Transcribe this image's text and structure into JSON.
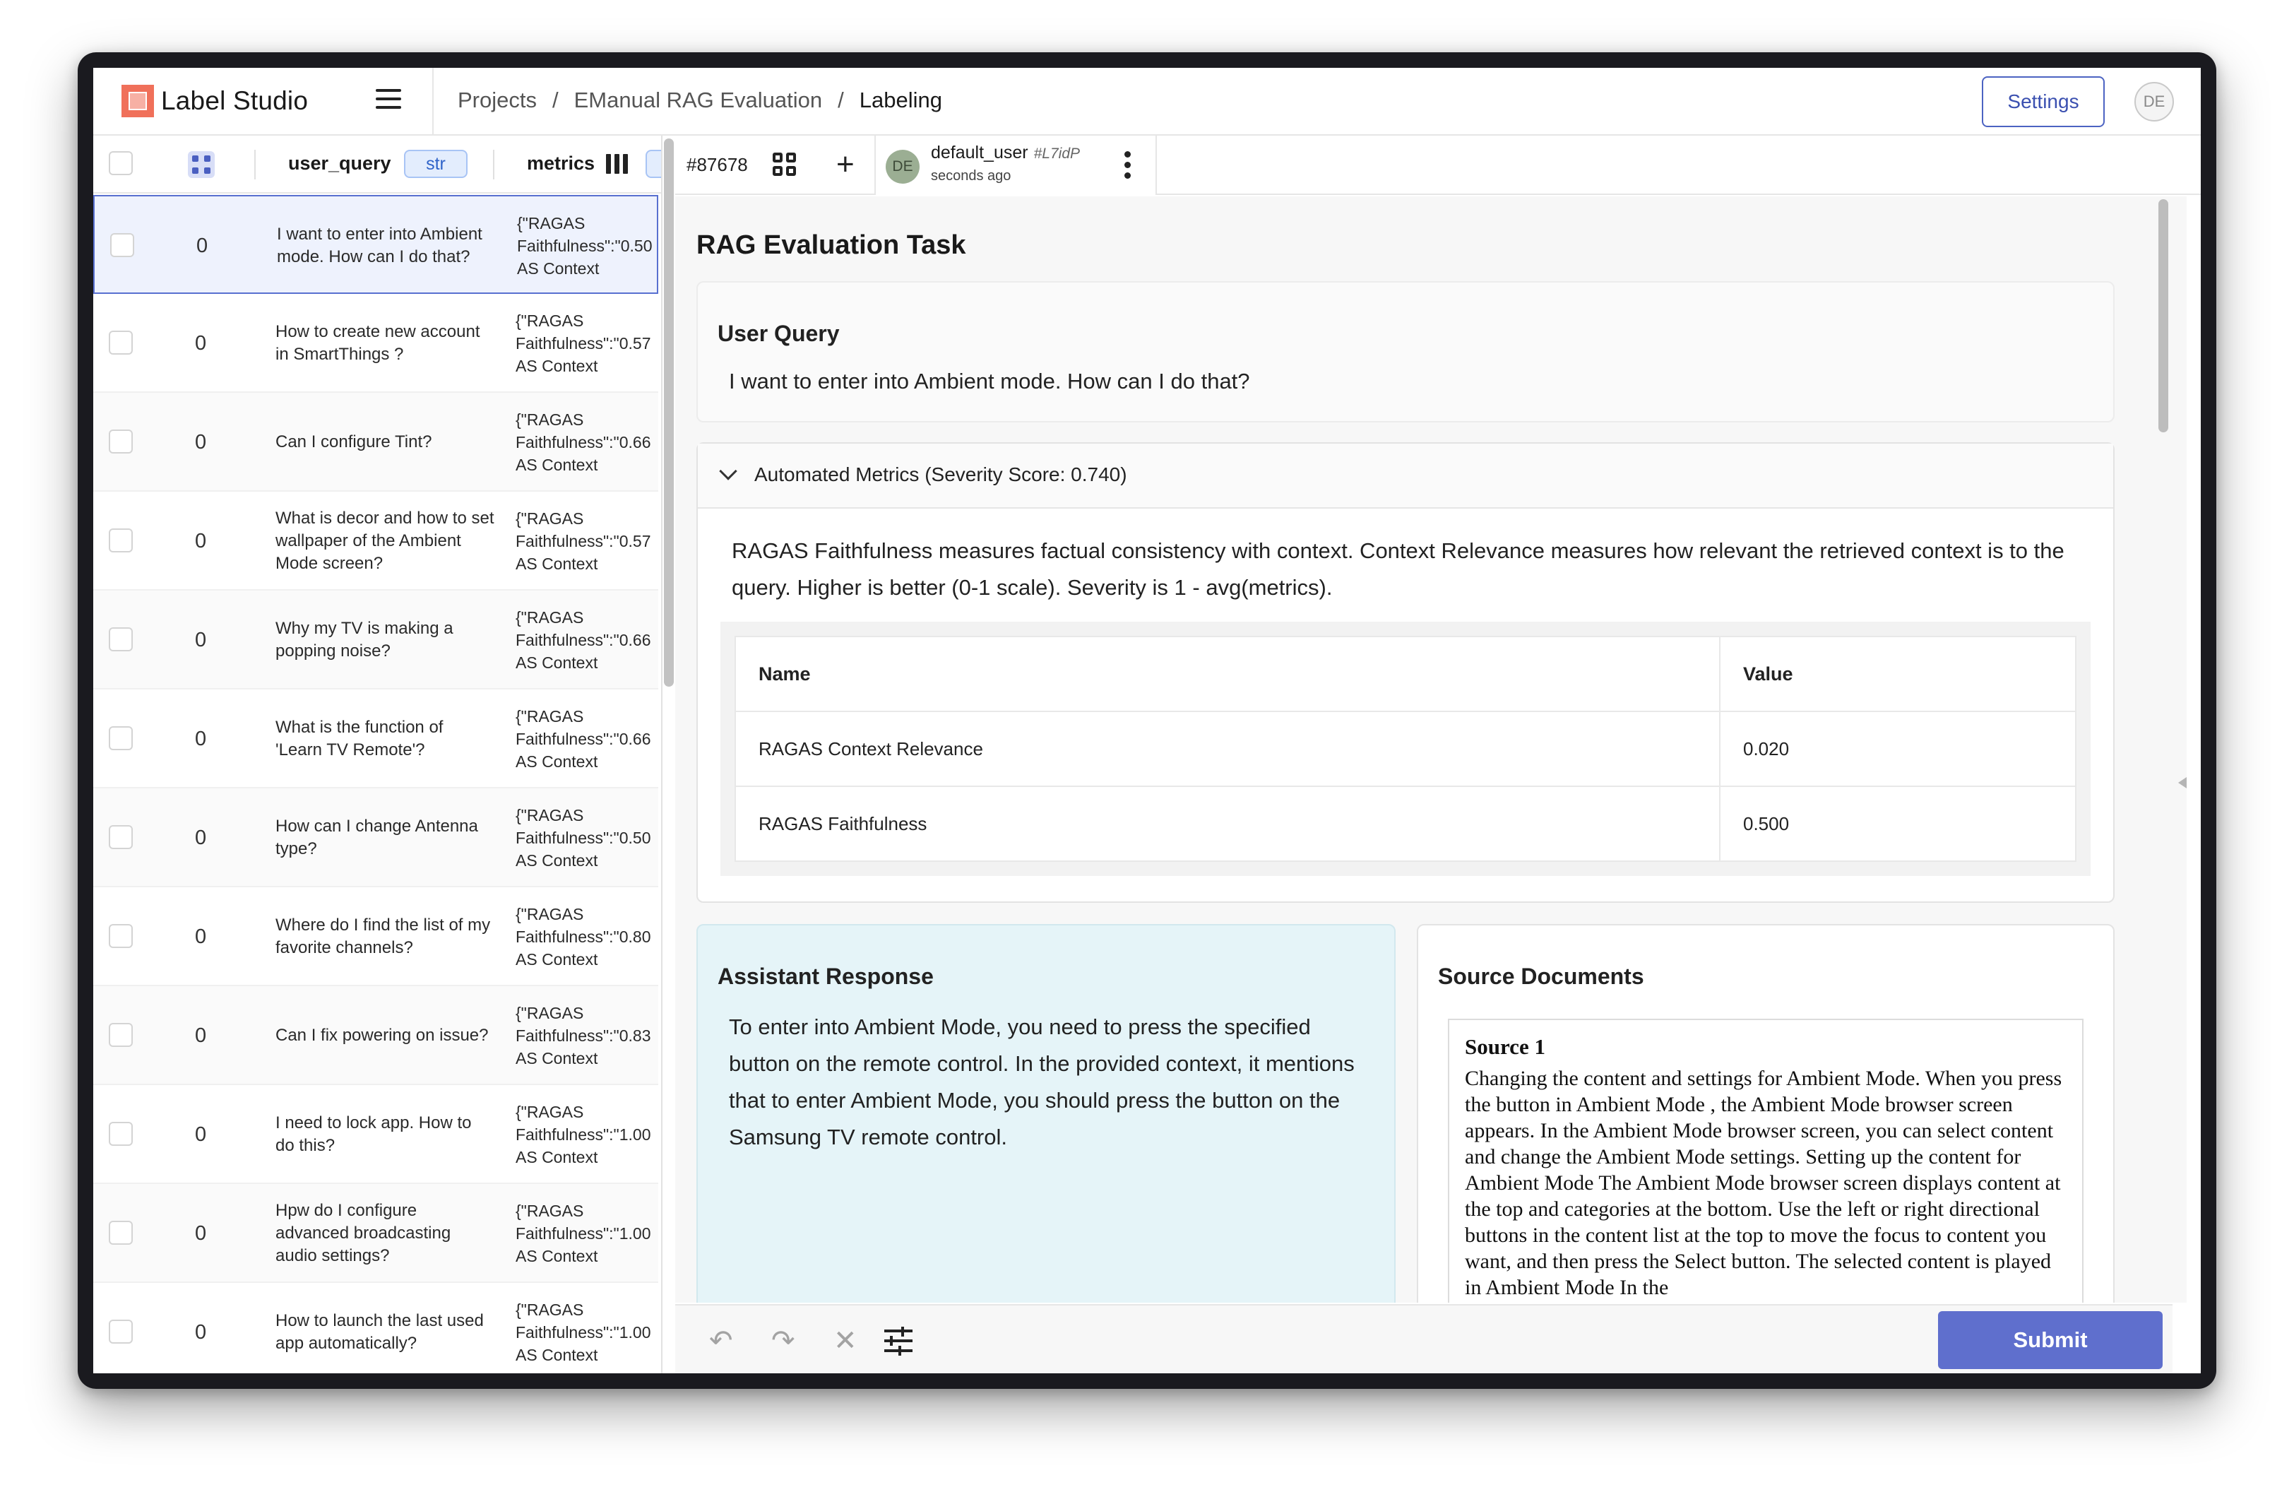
{
  "app": {
    "name": "Label Studio",
    "logo_icon": "label-studio-logo-icon",
    "brand_color": "#f0705a",
    "accent_color": "#4c63c2"
  },
  "header": {
    "breadcrumb": {
      "projects": "Projects",
      "sep1": "/",
      "project": "EManual RAG Evaluation",
      "sep2": "/",
      "current": "Labeling"
    },
    "settings_label": "Settings",
    "avatar_initials": "DE"
  },
  "table": {
    "columns": {
      "query": "user_query",
      "query_type": "str",
      "metrics": "metrics"
    },
    "rows": [
      {
        "count": "0",
        "query": "I want to enter into Ambient mode. How can I do that?",
        "m1": "{\"RAGAS",
        "m2": "Faithfulness\":\"0.50",
        "m3": "AS Context"
      },
      {
        "count": "0",
        "query": "How to create new account in SmartThings ?",
        "m1": "{\"RAGAS",
        "m2": "Faithfulness\":\"0.57",
        "m3": "AS Context"
      },
      {
        "count": "0",
        "query": "Can I configure Tint?",
        "m1": "{\"RAGAS",
        "m2": "Faithfulness\":\"0.66",
        "m3": "AS Context"
      },
      {
        "count": "0",
        "query": "What is decor and how to set wallpaper of the Ambient Mode screen?",
        "m1": "{\"RAGAS",
        "m2": "Faithfulness\":\"0.57",
        "m3": "AS Context"
      },
      {
        "count": "0",
        "query": "Why my TV is making a popping noise?",
        "m1": "{\"RAGAS",
        "m2": "Faithfulness\":\"0.66",
        "m3": "AS Context"
      },
      {
        "count": "0",
        "query": "What is the function of 'Learn TV Remote'?",
        "m1": "{\"RAGAS",
        "m2": "Faithfulness\":\"0.66",
        "m3": "AS Context"
      },
      {
        "count": "0",
        "query": "How can I change Antenna type?",
        "m1": "{\"RAGAS",
        "m2": "Faithfulness\":\"0.50",
        "m3": "AS Context"
      },
      {
        "count": "0",
        "query": "Where do I find the list of my favorite channels?",
        "m1": "{\"RAGAS",
        "m2": "Faithfulness\":\"0.80",
        "m3": "AS Context"
      },
      {
        "count": "0",
        "query": "Can I fix powering on issue?",
        "m1": "{\"RAGAS",
        "m2": "Faithfulness\":\"0.83",
        "m3": "AS Context"
      },
      {
        "count": "0",
        "query": "I need to lock app. How to do this?",
        "m1": "{\"RAGAS",
        "m2": "Faithfulness\":\"1.00",
        "m3": "AS Context"
      },
      {
        "count": "0",
        "query": "Hpw do I configure advanced broadcasting audio settings?",
        "m1": "{\"RAGAS",
        "m2": "Faithfulness\":\"1.00",
        "m3": "AS Context"
      },
      {
        "count": "0",
        "query": "How to launch the last used app automatically?",
        "m1": "{\"RAGAS",
        "m2": "Faithfulness\":\"1.00",
        "m3": "AS Context"
      }
    ]
  },
  "task": {
    "id": "#87678",
    "annotator": {
      "initials": "DE",
      "name": "default_user",
      "id": "#L7idP",
      "time": "seconds ago"
    }
  },
  "main": {
    "title": "RAG Evaluation Task",
    "user_query": {
      "heading": "User Query",
      "text": "I want to enter into Ambient mode. How can I do that?"
    },
    "metrics": {
      "accordion_title": "Automated Metrics (Severity Score: 0.740)",
      "description": "RAGAS Faithfulness measures factual consistency with context. Context Relevance measures how relevant the retrieved context is to the query. Higher is better (0-1 scale). Severity is 1 - avg(metrics).",
      "headers": {
        "name": "Name",
        "value": "Value"
      },
      "rows": [
        {
          "name": "RAGAS Context Relevance",
          "value": "0.020"
        },
        {
          "name": "RAGAS Faithfulness",
          "value": "0.500"
        }
      ]
    },
    "response": {
      "heading": "Assistant Response",
      "text": "To enter into Ambient Mode, you need to press the specified button on the remote control. In the provided context, it mentions that to enter Ambient Mode, you should press the button on the Samsung TV remote control.",
      "bg_color": "#e5f4f8"
    },
    "sources": {
      "heading": "Source Documents",
      "items": [
        {
          "title": "Source 1",
          "text": "Changing the content and settings for Ambient Mode. When you press the button in Ambient Mode , the Ambient Mode browser screen appears. In the Ambient Mode browser screen, you can select content and change the Ambient Mode settings. Setting up the content for Ambient Mode The Ambient Mode browser screen displays content at the top and categories at the bottom. Use the left or right directional buttons in the content list at the top to move the focus to content you want, and then press the Select button. The selected content is played in Ambient Mode In the"
        }
      ]
    }
  },
  "footer": {
    "undo_icon": "undo-icon",
    "redo_icon": "redo-icon",
    "reset_icon": "close-icon",
    "settings_icon": "sliders-icon",
    "submit_label": "Submit",
    "submit_color": "#5f6fcd"
  }
}
